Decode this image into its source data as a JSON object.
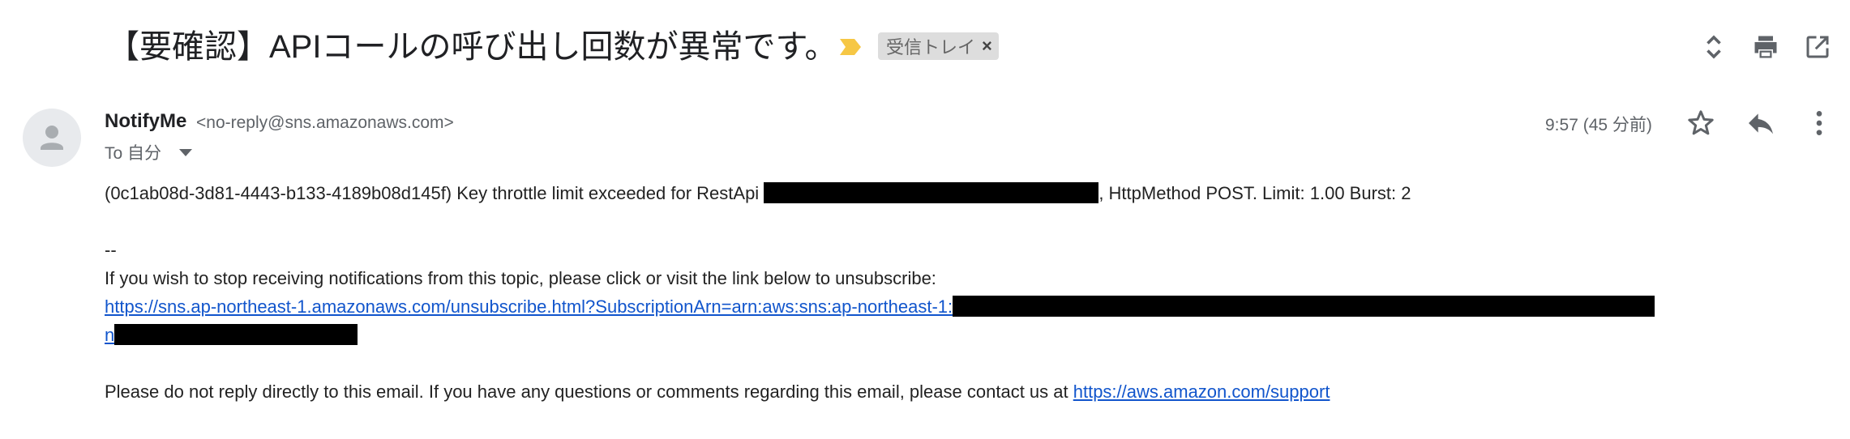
{
  "subject": {
    "title": "【要確認】APIコールの呼び出し回数が異常です。",
    "label": "受信トレイ",
    "label_close": "×"
  },
  "toolbar": {
    "icons": [
      "expand-collapse-icon",
      "print-icon",
      "open-in-new-window-icon"
    ]
  },
  "sender": {
    "name": "NotifyMe",
    "email": "<no-reply@sns.amazonaws.com>",
    "to": "To 自分",
    "timestamp": "9:57 (45 分前)"
  },
  "header_actions": [
    "star-icon",
    "reply-icon",
    "more-options-icon"
  ],
  "body": {
    "line1_prefix": "(0c1ab08d-3d81-4443-b133-4189b08d145f) Key throttle limit exceeded for RestApi ",
    "line1_suffix": ", HttpMethod POST. Limit: 1.00 Burst: 2",
    "separator": "--",
    "unsubscribe_text": "If you wish to stop receiving notifications from this topic, please click or visit the link below to unsubscribe:",
    "unsubscribe_link": "https://sns.ap-northeast-1.amazonaws.com/unsubscribe.html?SubscriptionArn=arn:aws:sns:ap-northeast-1:",
    "unsubscribe_link_line2": "n",
    "footer_text": "Please do not reply directly to this email. If you have any questions or comments regarding this email, please contact us at ",
    "support_link": "https://aws.amazon.com/support"
  },
  "colors": {
    "link": "#1155cc",
    "importance": "#f6c745",
    "chip_bg": "#dddddd"
  }
}
